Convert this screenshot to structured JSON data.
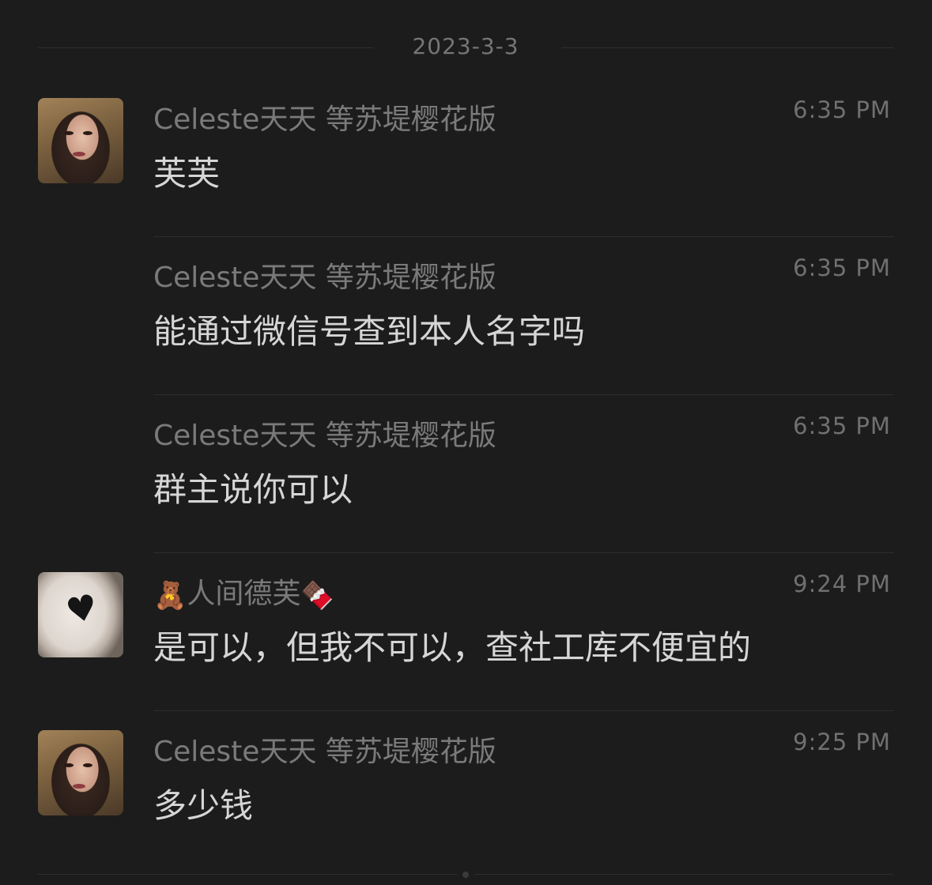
{
  "date_separator": "2023-3-3",
  "messages": [
    {
      "avatar": "avatar-portrait-woman",
      "name": "Celeste天天 等苏堤樱花版",
      "time": "6:35 PM",
      "text": "芙芙"
    },
    {
      "avatar": "",
      "name": "Celeste天天 等苏堤樱花版",
      "time": "6:35 PM",
      "text": "能通过微信号查到本人名字吗"
    },
    {
      "avatar": "",
      "name": "Celeste天天 等苏堤樱花版",
      "time": "6:35 PM",
      "text": "群主说你可以"
    },
    {
      "avatar": "avatar-white-fluff-heart",
      "name_prefix_emoji": "🧸",
      "name": "人间德芙",
      "name_suffix_emoji": "🍫",
      "time": "9:24 PM",
      "text": "是可以，但我不可以，查社工库不便宜的"
    },
    {
      "avatar": "avatar-portrait-woman",
      "name": "Celeste天天 等苏堤樱花版",
      "time": "9:25 PM",
      "text": "多少钱"
    }
  ],
  "colors": {
    "background": "#1c1c1c",
    "name_text": "#7a7a7a",
    "message_text": "#d6d6d6",
    "time_text": "#707070",
    "divider": "#2d2d2d"
  }
}
